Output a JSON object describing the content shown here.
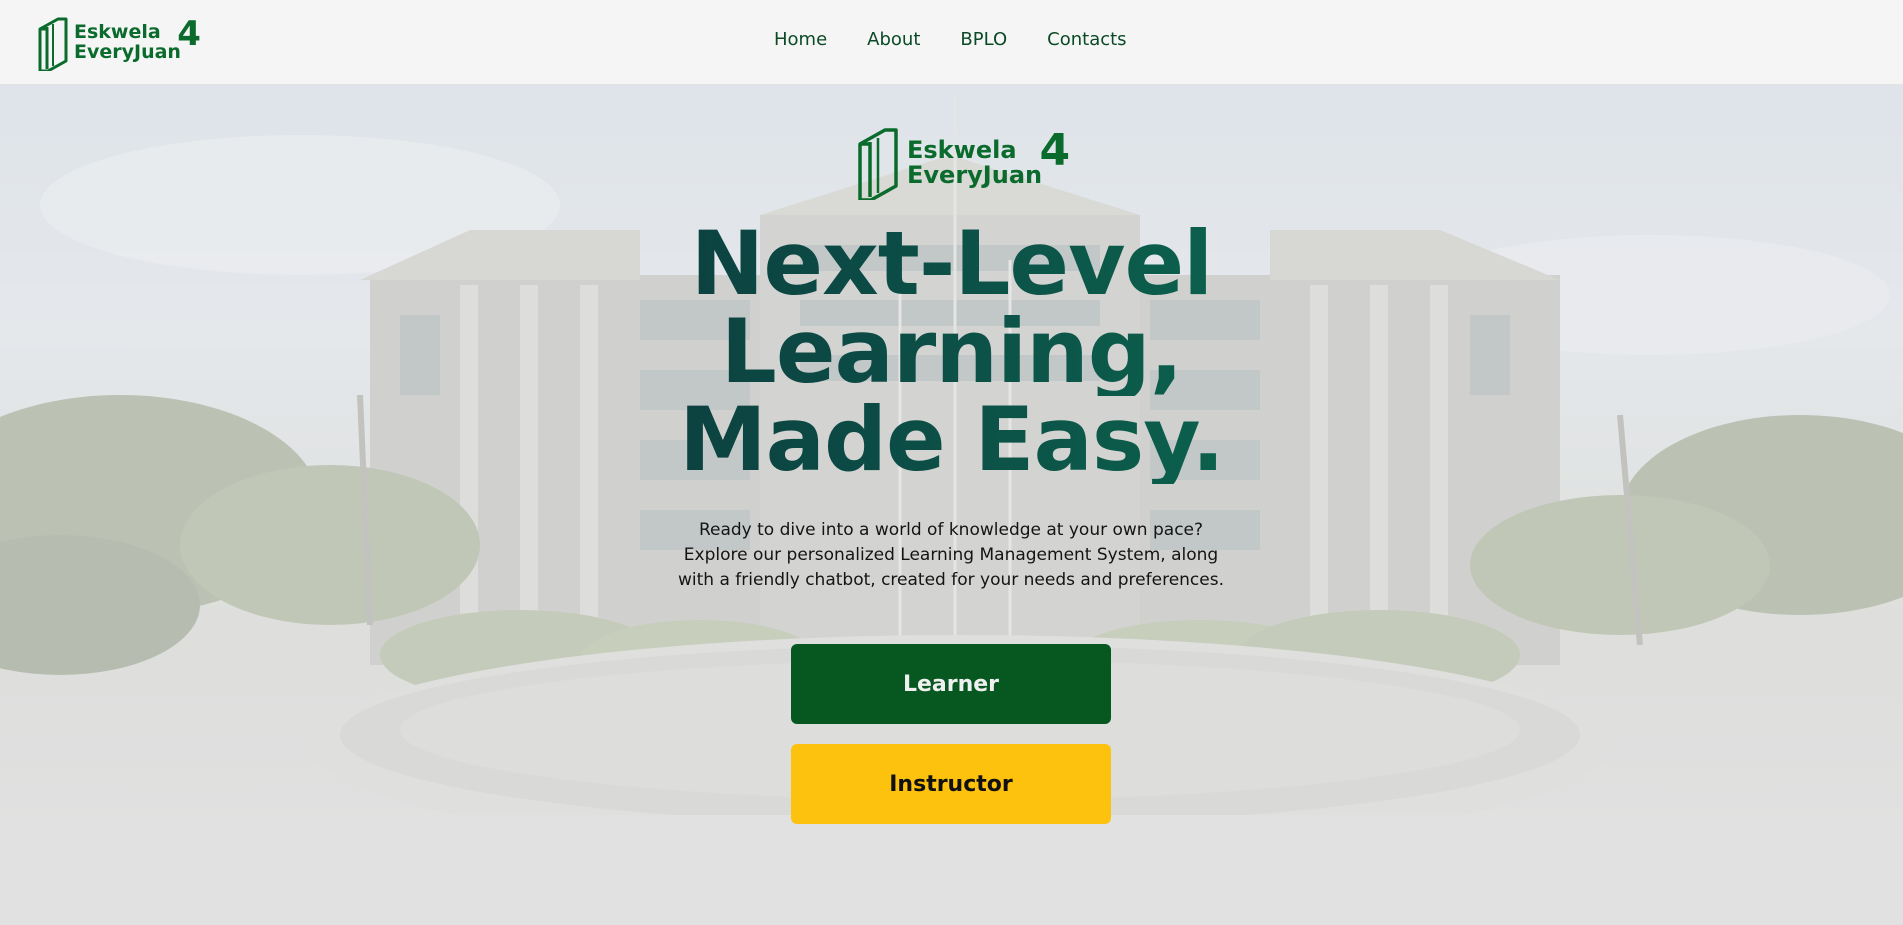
{
  "brand": {
    "line1": "Eskwela",
    "line2": "EveryJuan",
    "number": "4",
    "color": "#0a6b2c"
  },
  "nav": {
    "items": [
      {
        "label": "Home"
      },
      {
        "label": "About"
      },
      {
        "label": "BPLO"
      },
      {
        "label": "Contacts"
      }
    ]
  },
  "hero": {
    "headline": [
      "Next-Level",
      "Learning,",
      "Made Easy."
    ],
    "description": "Ready to dive into a world of knowledge at your own pace? Explore our personalized Learning Management System, along with a friendly chatbot, created for your needs and preferences.",
    "buttons": {
      "learner": "Learner",
      "instructor": "Instructor"
    },
    "colors": {
      "learner_bg": "#065720",
      "instructor_bg": "#fcc20e",
      "headline_start": "#0d2430",
      "headline_end": "#0a8a5a"
    }
  }
}
